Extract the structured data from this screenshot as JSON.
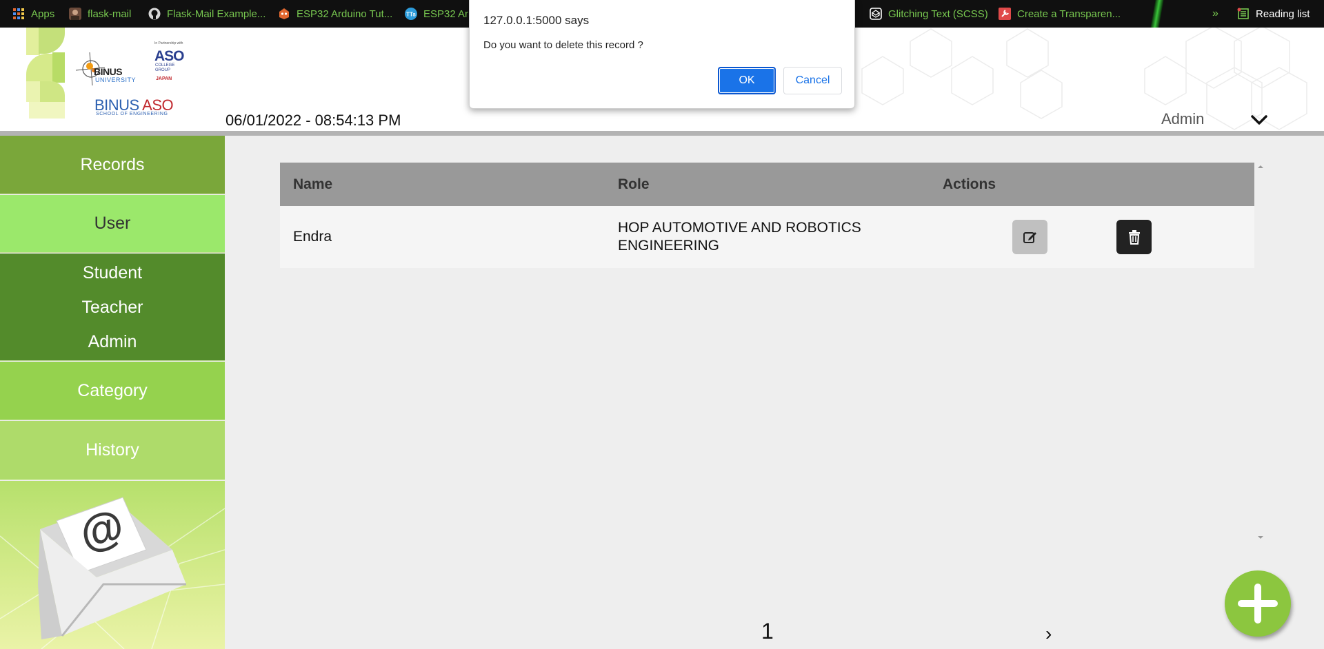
{
  "bookmarks": {
    "items": [
      {
        "label": "Apps",
        "icon": "apps-grid-icon"
      },
      {
        "label": "flask-mail",
        "icon": "avatar-icon"
      },
      {
        "label": "Flask-Mail Example...",
        "icon": "github-icon"
      },
      {
        "label": "ESP32 Arduino Tut...",
        "icon": "robot-icon"
      },
      {
        "label": "ESP32 Ar",
        "icon": "tts-icon"
      },
      {
        "label": "Glitching Text (SCSS)",
        "icon": "codepen-icon"
      },
      {
        "label": "Create a Transparen...",
        "icon": "wrench-icon"
      }
    ],
    "overflow": "»",
    "reading_list": "Reading list"
  },
  "header": {
    "logo": {
      "binus": "BINUS",
      "university": "UNIVERSITY",
      "partner": "In Partnership with",
      "aso": "ASO",
      "aso_sub": "COLLEGE GROUP",
      "japan": "JAPAN",
      "binus_aso_1": "BINUS ",
      "binus_aso_2": "ASO",
      "school": "SCHOOL OF ENGINEERING"
    },
    "datetime": "06/01/2022 - 08:54:13 PM",
    "user": "Admin"
  },
  "sidebar": {
    "records": "Records",
    "user": "User",
    "sub": [
      "Student",
      "Teacher",
      "Admin"
    ],
    "category": "Category",
    "history": "History"
  },
  "table": {
    "headers": [
      "Name",
      "Role",
      "Actions"
    ],
    "rows": [
      {
        "name": "Endra",
        "role_line1": "HOP AUTOMOTIVE AND ROBOTICS",
        "role_line2": "ENGINEERING"
      }
    ]
  },
  "pagination": {
    "current": "1",
    "next": "›"
  },
  "dialog": {
    "title": "127.0.0.1:5000 says",
    "message": "Do you want to delete this record ?",
    "ok": "OK",
    "cancel": "Cancel"
  },
  "colors": {
    "sidebar_records": "#7aa73a",
    "sidebar_user": "#9be86b",
    "sidebar_sub": "#538b2b",
    "sidebar_category": "#95d24e",
    "sidebar_history": "#aedb6a",
    "fab": "#8cc63f",
    "dialog_ok": "#1a73e8"
  }
}
